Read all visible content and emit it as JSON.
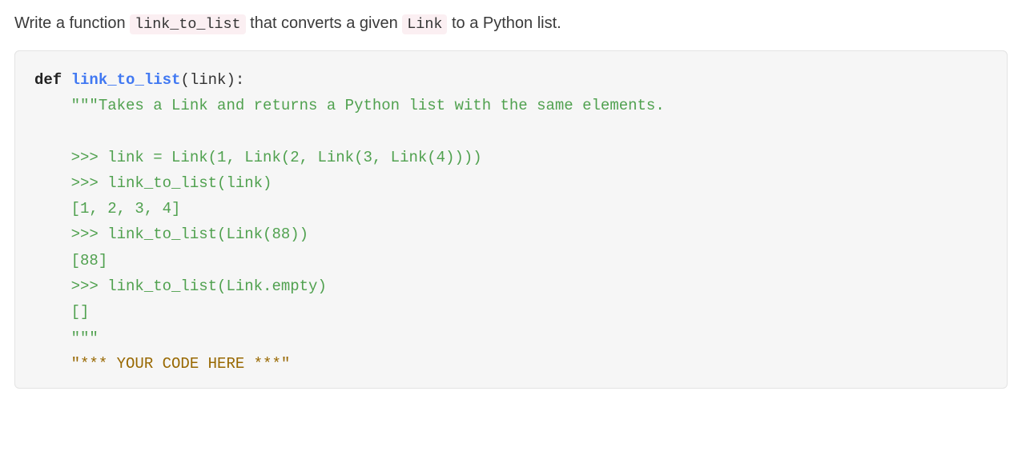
{
  "prompt": {
    "part1": "Write a function ",
    "code1": "link_to_list",
    "part2": " that converts a given ",
    "code2": "Link",
    "part3": " to a Python list."
  },
  "code": {
    "def_keyword": "def",
    "func_name": "link_to_list",
    "signature_tail": "(link):",
    "docstring_open": "\"\"\"Takes a Link and returns a Python list with the same elements.",
    "example1_call": ">>> link = Link(1, Link(2, Link(3, Link(4))))",
    "example1_call2": ">>> link_to_list(link)",
    "example1_result": "[1, 2, 3, 4]",
    "example2_call": ">>> link_to_list(Link(88))",
    "example2_result": "[88]",
    "example3_call": ">>> link_to_list(Link.empty)",
    "example3_result": "[]",
    "docstring_close": "\"\"\"",
    "placeholder_text": "\"*** YOUR CODE HERE ***\""
  }
}
